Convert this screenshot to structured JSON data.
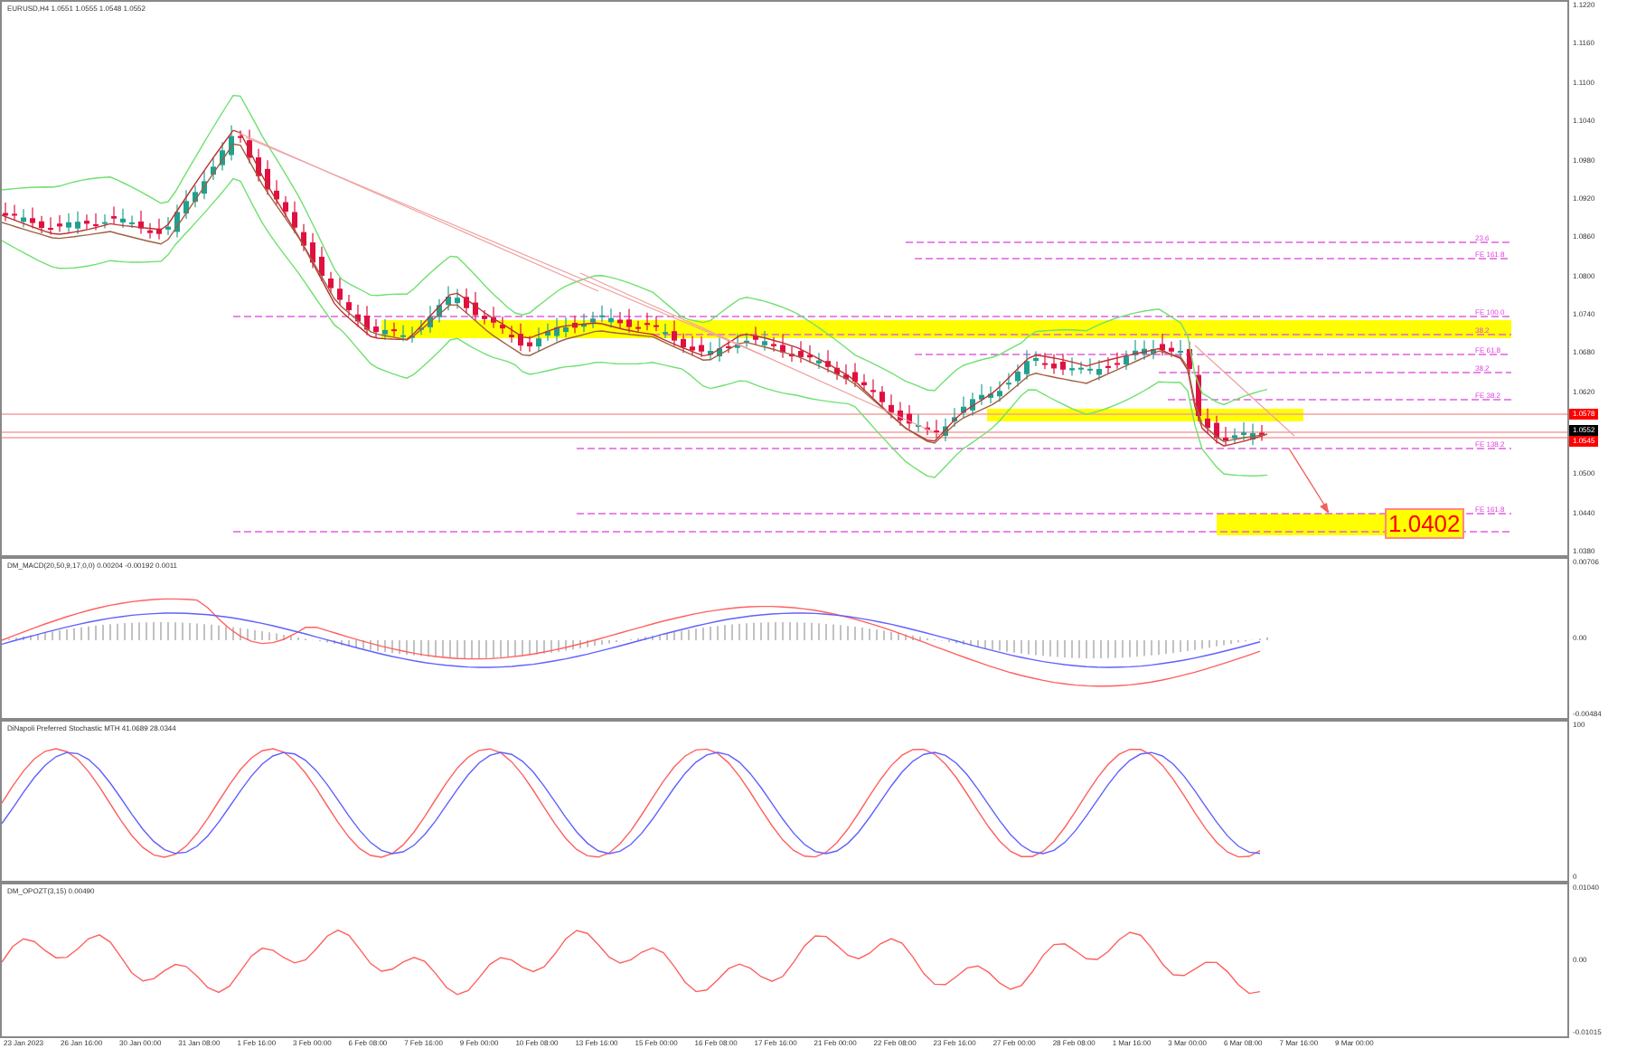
{
  "chart_title": "EURUSD,H4  1.0551 1.0555 1.0548 1.0552",
  "price_axis": [
    "1.1220",
    "1.1160",
    "1.1100",
    "1.1040",
    "1.0980",
    "1.0920",
    "1.0860",
    "1.0800",
    "1.0740",
    "1.0680",
    "1.0620",
    "1.0500",
    "1.0440",
    "1.0380"
  ],
  "price_tags": [
    {
      "text": "1.0578",
      "color": "#ff0000"
    },
    {
      "text": "1.0552",
      "color": "#000000"
    },
    {
      "text": "1.0545",
      "color": "#ff0000"
    }
  ],
  "fib_labels": [
    "23.6",
    "FE 161.8",
    "FE 100.0",
    "38.2",
    "FE 61.8",
    "38.2",
    "FE 38.2",
    "FE 138.2",
    "FE 161.8"
  ],
  "target_label": "1.0402",
  "indicators": [
    {
      "title": "DM_MACD(20,50,9,17,0,0) 0.00204 -0.00192 0.0011",
      "axis": [
        "0.00706",
        "0.00",
        "-0.00484"
      ]
    },
    {
      "title": "DiNapoli Preferred Stochastic MTH 41.0689 28.0344",
      "axis": [
        "100",
        "0"
      ]
    },
    {
      "title": "DM_OPOZT(3,15) 0.00490",
      "axis": [
        "0.01040",
        "0.00",
        "-0.01015"
      ]
    }
  ],
  "time_axis": [
    "23 Jan 2023",
    "26 Jan 16:00",
    "30 Jan 00:00",
    "31 Jan 08:00",
    "1 Feb 16:00",
    "3 Feb 00:00",
    "6 Feb 08:00",
    "7 Feb 16:00",
    "9 Feb 00:00",
    "10 Feb 08:00",
    "13 Feb 16:00",
    "15 Feb 00:00",
    "16 Feb 08:00",
    "17 Feb 16:00",
    "21 Feb 00:00",
    "22 Feb 08:00",
    "23 Feb 16:00",
    "27 Feb 00:00",
    "28 Feb 08:00",
    "1 Mar 16:00",
    "3 Mar 00:00",
    "6 Mar 08:00",
    "7 Mar 16:00",
    "9 Mar 00:00"
  ]
}
